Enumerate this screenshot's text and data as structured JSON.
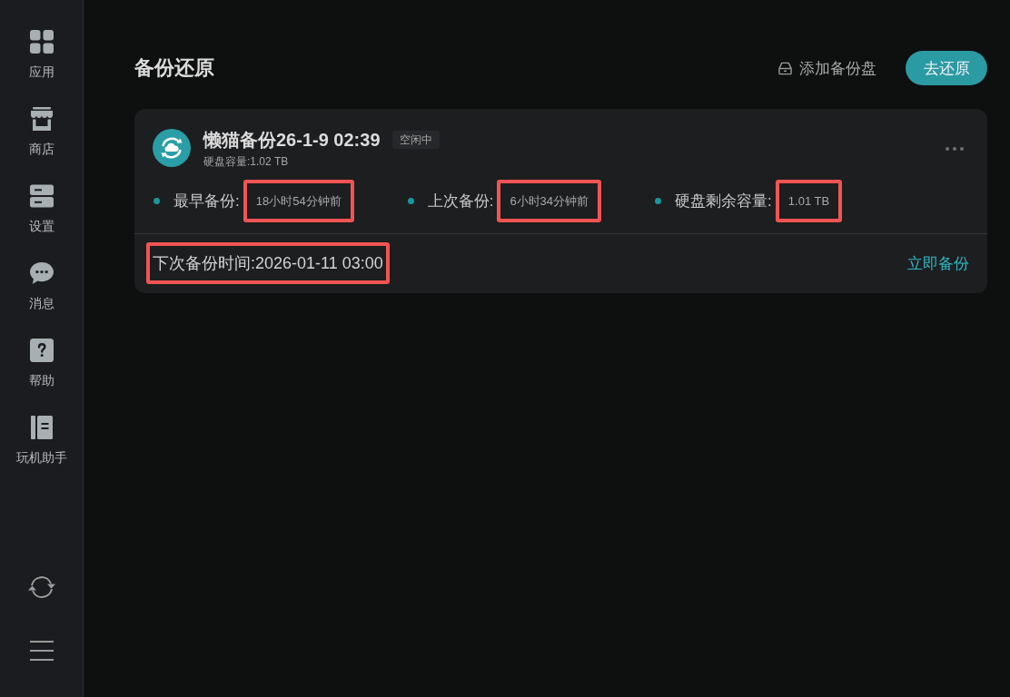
{
  "sidebar": {
    "items": [
      {
        "kind": "apps",
        "label": "应用"
      },
      {
        "kind": "store",
        "label": "商店"
      },
      {
        "kind": "settings",
        "label": "设置"
      },
      {
        "kind": "messages",
        "label": "消息"
      },
      {
        "kind": "help",
        "label": "帮助"
      },
      {
        "kind": "guide",
        "label": "玩机助手"
      }
    ]
  },
  "page": {
    "title": "备份还原"
  },
  "toolbar": {
    "add_disk": "添加备份盘",
    "restore_button": "去还原"
  },
  "backup_card": {
    "title": "懒猫备份26-1-9 02:39",
    "status": "空闲中",
    "capacity": "硬盘容量:1.02 TB",
    "stats": [
      {
        "label": "最早备份:",
        "value": "18小时54分钟前",
        "highlighted": true
      },
      {
        "label": "上次备份:",
        "value": "6小时34分钟前",
        "highlighted": true
      },
      {
        "label": "硬盘剩余容量:",
        "value": "1.01 TB",
        "highlighted": true
      }
    ],
    "next_backup": {
      "text": "下次备份时间:2026-01-11 03:00",
      "highlighted": true
    },
    "backup_now": "立即备份"
  }
}
